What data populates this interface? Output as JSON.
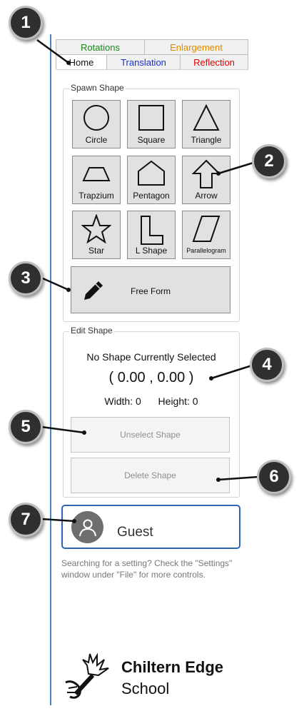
{
  "tabs": {
    "top": [
      {
        "label": "Rotations",
        "color": "#1a8a1a"
      },
      {
        "label": "Enlargement",
        "color": "#e08a00"
      }
    ],
    "bottom": [
      {
        "label": "Home",
        "color": "#111111"
      },
      {
        "label": "Translation",
        "color": "#1a2fd0"
      },
      {
        "label": "Reflection",
        "color": "#e00000"
      }
    ]
  },
  "spawn_shape": {
    "title": "Spawn Shape",
    "shapes": [
      {
        "label": "Circle",
        "icon": "circle-icon"
      },
      {
        "label": "Square",
        "icon": "square-icon"
      },
      {
        "label": "Triangle",
        "icon": "triangle-icon"
      },
      {
        "label": "Trapzium",
        "icon": "trapezium-icon"
      },
      {
        "label": "Pentagon",
        "icon": "pentagon-icon"
      },
      {
        "label": "Arrow",
        "icon": "arrow-icon"
      },
      {
        "label": "Star",
        "icon": "star-icon"
      },
      {
        "label": "L Shape",
        "icon": "l-shape-icon"
      },
      {
        "label": "Parallelogram",
        "icon": "parallelogram-icon"
      }
    ],
    "free_form": "Free Form"
  },
  "edit_shape": {
    "title": "Edit Shape",
    "status": "No Shape Currently Selected",
    "coords": "( 0.00 , 0.00 )",
    "width": "Width: 0",
    "height": "Height: 0",
    "unselect": "Unselect Shape",
    "delete": "Delete Shape"
  },
  "user": {
    "name": "Guest"
  },
  "hint": "Searching for a setting? Check the \"Settings\"  window under \"File\" for more controls.",
  "school": {
    "name": "Chiltern Edge",
    "sub": "School"
  },
  "callouts": [
    "1",
    "2",
    "3",
    "4",
    "5",
    "6",
    "7"
  ]
}
